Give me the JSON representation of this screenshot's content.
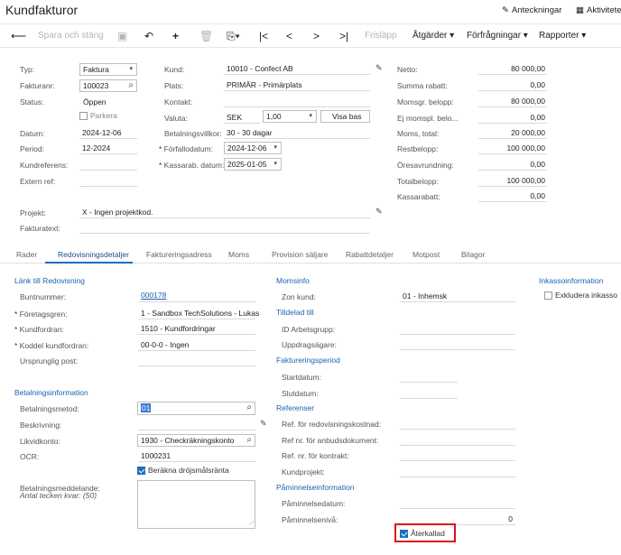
{
  "header": {
    "title": "Kundfakturor",
    "notes_label": "Anteckningar",
    "activities_label": "Aktiviteter"
  },
  "toolbar": {
    "save_close": "Spara och stäng",
    "release": "Frisläpp",
    "actions": "Åtgärder",
    "inquiries": "Förfrågningar",
    "reports": "Rapporter"
  },
  "summary": {
    "type_label": "Typ:",
    "type_value": "Faktura",
    "invoice_no_label": "Fakturanr:",
    "invoice_no_value": "100023",
    "status_label": "Status:",
    "status_value": "Öppen",
    "hold_label": "Parkera",
    "date_label": "Datum:",
    "date_value": "2024-12-06",
    "period_label": "Period:",
    "period_value": "12-2024",
    "customer_ref_label": "Kundreferens:",
    "ext_ref_label": "Extern ref:",
    "customer_label": "Kund:",
    "customer_value": "10010 - Confect AB",
    "location_label": "Plats:",
    "location_value": "PRIMÄR - Primärplats",
    "contact_label": "Kontakt:",
    "currency_label": "Valuta:",
    "currency_value": "SEK",
    "rate_value": "1,00",
    "base_button": "Visa bas",
    "terms_label": "Betalningsvillkor:",
    "terms_value": "30 - 30 dagar",
    "due_label": "Förfallodatum:",
    "due_value": "2024-12-06",
    "cashdisc_label": "Kassarab. datum:",
    "cashdisc_value": "2025-01-05",
    "project_label": "Projekt:",
    "project_value": "X - Ingen projektkod.",
    "invoice_text_label": "Fakturatext:",
    "totals": [
      {
        "label": "Netto:",
        "value": "80 000,00"
      },
      {
        "label": "Summa rabatt:",
        "value": "0,00"
      },
      {
        "label": "Momsgr. belopp:",
        "value": "80 000,00"
      },
      {
        "label": "Ej momspl. belo...",
        "value": "0,00"
      },
      {
        "label": "Moms, total:",
        "value": "20 000,00"
      },
      {
        "label": "Restbelopp:",
        "value": "100 000,00"
      },
      {
        "label": "Öresavrundning:",
        "value": "0,00"
      },
      {
        "label": "Totalbelopp:",
        "value": "100 000,00"
      },
      {
        "label": "Kassarabatt:",
        "value": "0,00"
      }
    ]
  },
  "tabs": [
    "Rader",
    "Redovisningsdetaljer",
    "Faktureringsadress",
    "Moms",
    "Provision säljare",
    "Rabattdetaljer",
    "Motpost",
    "Bilagor"
  ],
  "accounting": {
    "sec_link": "Länk till Redovisning",
    "batch_label": "Buntnummer:",
    "batch_value": "000178",
    "branch_label": "Företagsgren:",
    "branch_value": "1 - Sandbox TechSolutions - Lukas",
    "ar_account_label": "Kundfordran:",
    "ar_account_value": "1510 - Kundfordringar",
    "ar_sub_label": "Koddel kundfordran:",
    "ar_sub_value": "00-0-0 - Ingen",
    "orig_doc_label": "Ursprunglig post:",
    "sec_payment": "Betalningsinformation",
    "pay_method_label": "Betalningsmetod:",
    "pay_method_value": "01",
    "description_label": "Beskrivning:",
    "cash_account_label": "Likvidkonto:",
    "cash_account_value": "1930 - Checkräkningskonto",
    "ocr_label": "OCR:",
    "ocr_value": "1000231",
    "late_fee_label": "Beräkna dröjsmålsränta",
    "pay_message_label": "Betalningsmeddelande:",
    "chars_left_label": "Antal tecken kvar: (50)",
    "sec_vat": "Momsinfo",
    "vat_zone_label": "Zon kund:",
    "vat_zone_value": "01 - Inhemsk",
    "sec_assigned": "Tilldelad till",
    "workgroup_label": "ID Arbetsgrupp:",
    "owner_label": "Uppdragsägare:",
    "sec_billing_period": "Faktureringsperiod",
    "start_label": "Startdatum:",
    "end_label": "Slutdatum:",
    "sec_refs": "Referenser",
    "ref_cost_label": "Ref. för redovisningskostnad:",
    "ref_tender_label": "Ref nr. för anbudsdokument:",
    "ref_contract_label": "Ref. nr. för kontrakt:",
    "cust_project_label": "Kundprojekt:",
    "sec_dunning": "Påminnelseinformation",
    "dunning_date_label": "Påminnelsedatum:",
    "dunning_level_label": "Påminnelsenivå:",
    "dunning_level_value": "0",
    "recalled_label": "Återkallad",
    "sec_collection": "Inkassoinformation",
    "exclude_collection_label": "Exkludera inkasso"
  }
}
